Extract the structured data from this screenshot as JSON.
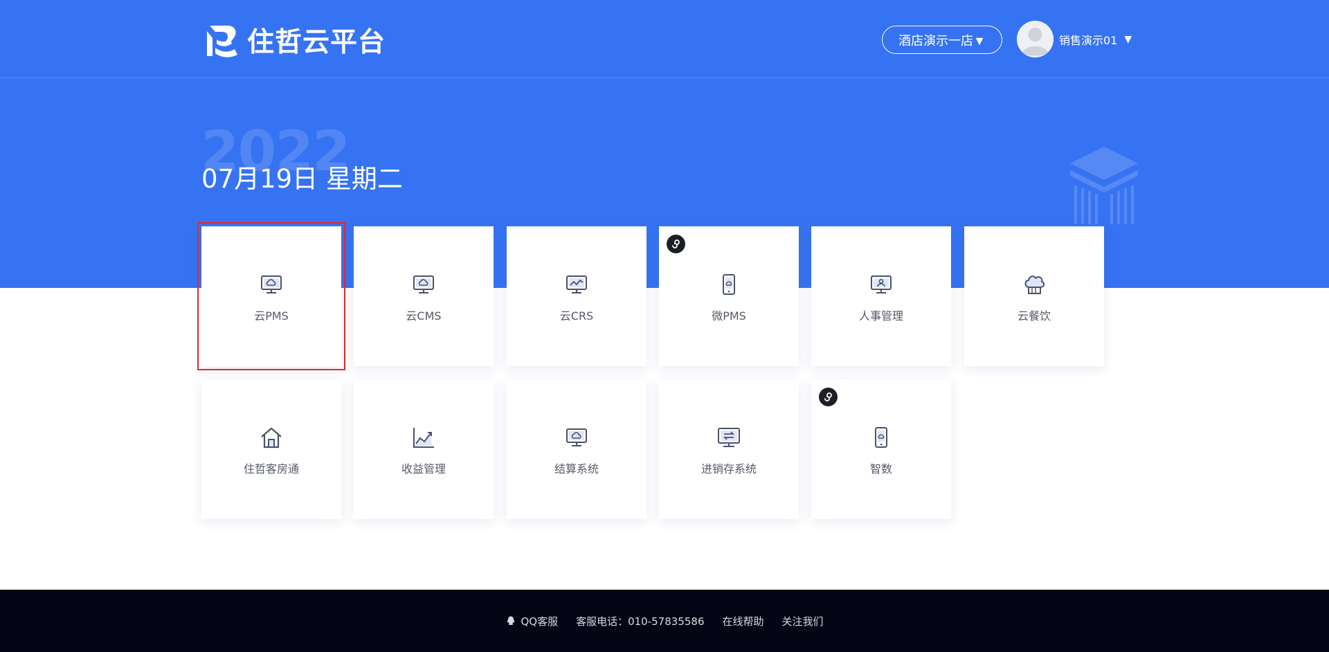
{
  "header": {
    "brand": "住哲云平台",
    "store_selector": "酒店演示一店▼",
    "user_name": "销售演示01",
    "user_caret": "▼"
  },
  "hero": {
    "year": "2022",
    "date": "07月19日 星期二"
  },
  "tiles": [
    {
      "label": "云PMS",
      "icon": "cloud-monitor-icon",
      "selected": true,
      "mini_program": false
    },
    {
      "label": "云CMS",
      "icon": "cloud-monitor-icon",
      "selected": false,
      "mini_program": false
    },
    {
      "label": "云CRS",
      "icon": "chart-monitor-icon",
      "selected": false,
      "mini_program": false
    },
    {
      "label": "微PMS",
      "icon": "phone-cloud-icon",
      "selected": false,
      "mini_program": true
    },
    {
      "label": "人事管理",
      "icon": "person-monitor-icon",
      "selected": false,
      "mini_program": false
    },
    {
      "label": "云餐饮",
      "icon": "chef-hat-icon",
      "selected": false,
      "mini_program": false
    },
    {
      "label": "住哲客房通",
      "icon": "house-icon",
      "selected": false,
      "mini_program": false
    },
    {
      "label": "收益管理",
      "icon": "area-chart-icon",
      "selected": false,
      "mini_program": false
    },
    {
      "label": "结算系统",
      "icon": "cloud-monitor-icon",
      "selected": false,
      "mini_program": false
    },
    {
      "label": "进销存系统",
      "icon": "exchange-monitor-icon",
      "selected": false,
      "mini_program": false
    },
    {
      "label": "智数",
      "icon": "phone-cloud-icon",
      "selected": false,
      "mini_program": true
    }
  ],
  "footer": {
    "qq": "QQ客服",
    "phone": "客服电话：010-57835586",
    "help": "在线帮助",
    "follow": "关注我们"
  },
  "colors": {
    "primary": "#3673f2",
    "footer_bg": "#030515",
    "selected_outline": "#e3282b",
    "icon_stroke": "#4a5268"
  }
}
